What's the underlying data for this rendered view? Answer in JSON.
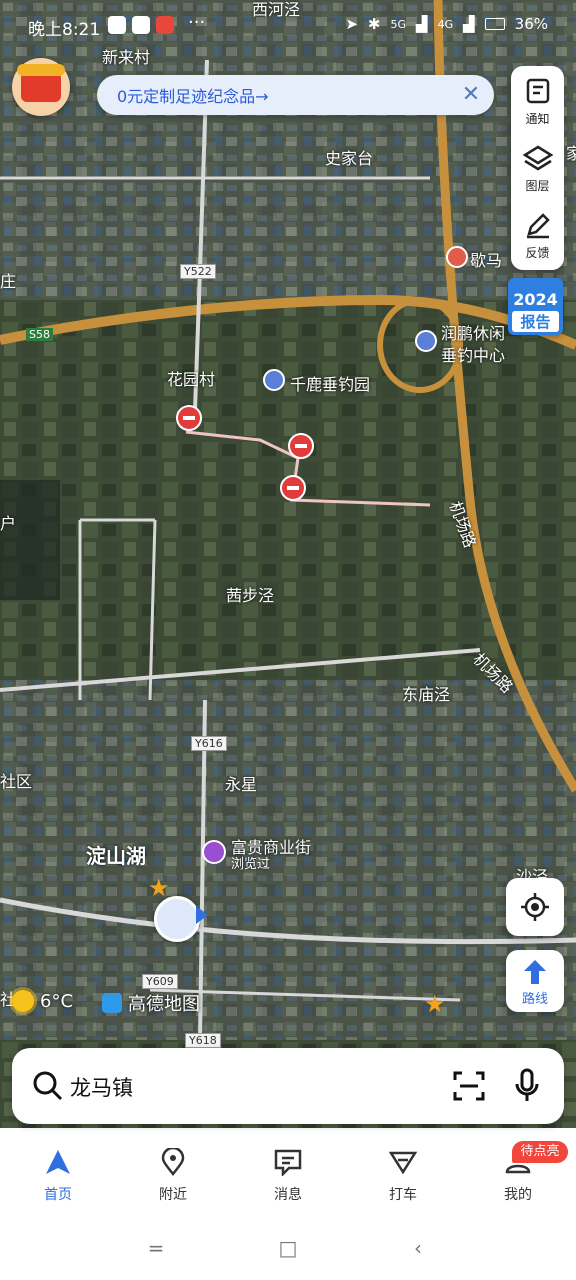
{
  "status_bar": {
    "time": "晚上8:21",
    "dots": "···",
    "battery": "36%",
    "network_labels": [
      "5G",
      "4G"
    ]
  },
  "banner": {
    "text": "0元定制足迹纪念品→",
    "close": "✕"
  },
  "side_toolbar": {
    "items": [
      {
        "label": "通知",
        "icon": "notice-icon"
      },
      {
        "label": "图层",
        "icon": "layers-icon"
      },
      {
        "label": "反馈",
        "icon": "feedback-icon"
      }
    ]
  },
  "report_badge": {
    "year": "2024",
    "label": "报告"
  },
  "map": {
    "places": [
      "西河泾",
      "新来村",
      "史家台",
      "歇马",
      "庄",
      "润鹏休闲",
      "垂钓中心",
      "花园村",
      "千鹿垂钓园",
      "户",
      "茜步泾",
      "机场路",
      "机场路",
      "东庙泾",
      "永星",
      "社区",
      "富贵商业街",
      "浏览过",
      "淀山湖",
      "沙泾",
      "社区",
      "家"
    ],
    "roads": [
      "Y522",
      "S58",
      "Y616",
      "Y609",
      "Y618"
    ]
  },
  "route_button": {
    "label": "路线"
  },
  "weather": {
    "temp": "6°C"
  },
  "brand": {
    "name": "高德地图"
  },
  "search": {
    "query": "龙马镇"
  },
  "tabbar": {
    "items": [
      {
        "label": "首页",
        "icon": "home-arrow-icon",
        "active": true
      },
      {
        "label": "附近",
        "icon": "location-pin-icon",
        "active": false
      },
      {
        "label": "消息",
        "icon": "message-icon",
        "active": false
      },
      {
        "label": "打车",
        "icon": "taxi-icon",
        "active": false
      },
      {
        "label": "我的",
        "icon": "profile-icon",
        "active": false
      }
    ],
    "badge": "待点亮"
  },
  "navbar": {
    "menu": "=",
    "home": "□",
    "back": "‹"
  },
  "colors": {
    "accent": "#2f6fe0",
    "badge_red": "#f2453c",
    "route_pink": "#f0c4c4"
  }
}
